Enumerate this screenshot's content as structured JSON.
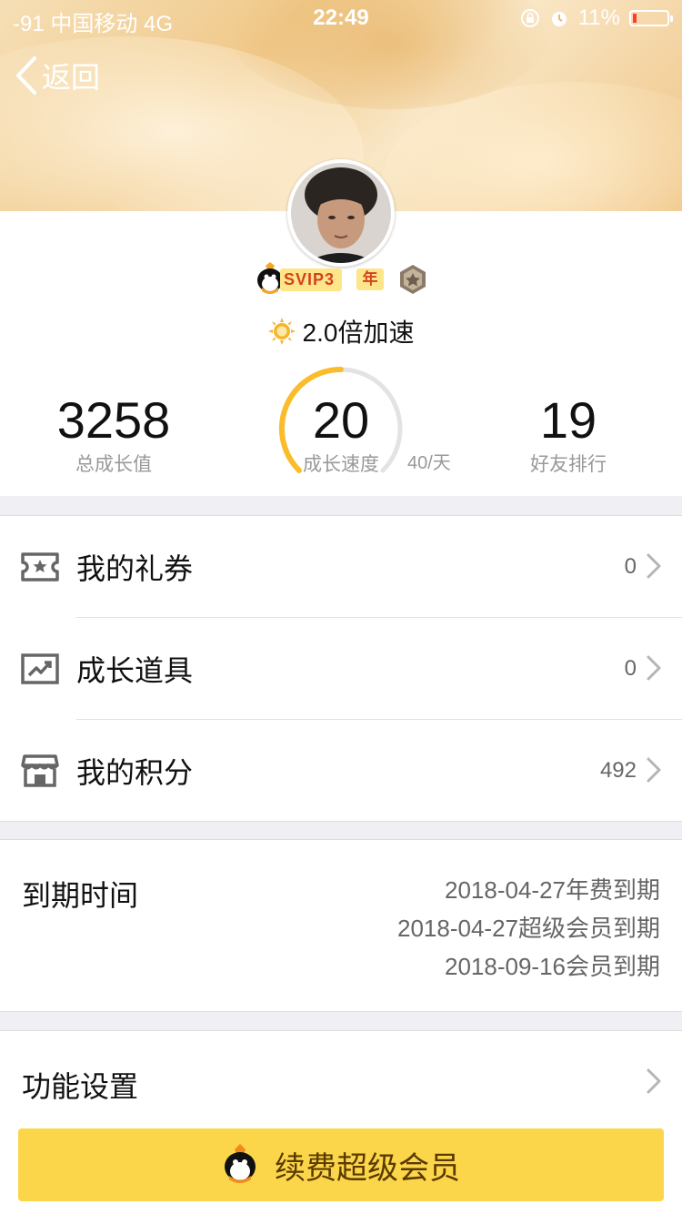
{
  "status_bar": {
    "carrier": "-91 中国移动   4G",
    "time": "22:49",
    "battery": "11%",
    "battery_level": 0.11,
    "icons": [
      "rotation-lock-icon",
      "alarm-icon",
      "battery-icon"
    ]
  },
  "nav": {
    "back_label": "返回",
    "back_icon": "chevron-left-icon"
  },
  "profile": {
    "vip_badge": "SVIP3",
    "year_badge": "年",
    "rank_icon": "rank-medal-icon",
    "speed_text": "2.0倍加速",
    "speed_icon": "sun-badge-icon",
    "stats": {
      "total_growth": {
        "value": "3258",
        "label": "总成长值"
      },
      "growth_speed": {
        "value": "20",
        "label": "成长速度",
        "max": "40/天",
        "fraction": 0.5
      },
      "friend_rank": {
        "value": "19",
        "label": "好友排行"
      }
    },
    "colors": {
      "gauge": "#fbbc2c",
      "gauge_track": "#e3e3e3"
    }
  },
  "menu": [
    {
      "label": "我的礼券",
      "value": "0",
      "icon": "coupon-ticket-icon"
    },
    {
      "label": "成长道具",
      "value": "0",
      "icon": "growth-chart-icon"
    },
    {
      "label": "我的积分",
      "value": "492",
      "icon": "store-icon"
    }
  ],
  "expiry": {
    "title": "到期时间",
    "lines": [
      "2018-04-27年费到期",
      "2018-04-27超级会员到期",
      "2018-09-16会员到期"
    ]
  },
  "settings": {
    "label": "功能设置"
  },
  "renew": {
    "label": "续费超级会员",
    "icon": "qq-penguin-icon",
    "color": "#fcd64a"
  }
}
